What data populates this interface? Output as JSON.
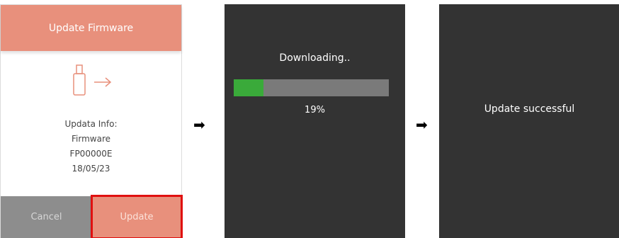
{
  "panel1": {
    "title": "Update Firmware",
    "icon": "usb-arrow-icon",
    "info_lines": [
      "Updata Info:",
      "Firmware",
      "FP00000E",
      "18/05/23"
    ],
    "cancel_label": "Cancel",
    "update_label": "Update"
  },
  "arrow_glyph": "➡",
  "panel2": {
    "status": "Downloading..",
    "progress_label": "19%",
    "progress_fraction": 0.19
  },
  "panel3": {
    "message": "Update successful"
  },
  "colors": {
    "accent": "#e8907c",
    "highlight": "#e01010",
    "dark_bg": "#333333",
    "progress": "#3aaa3a"
  }
}
